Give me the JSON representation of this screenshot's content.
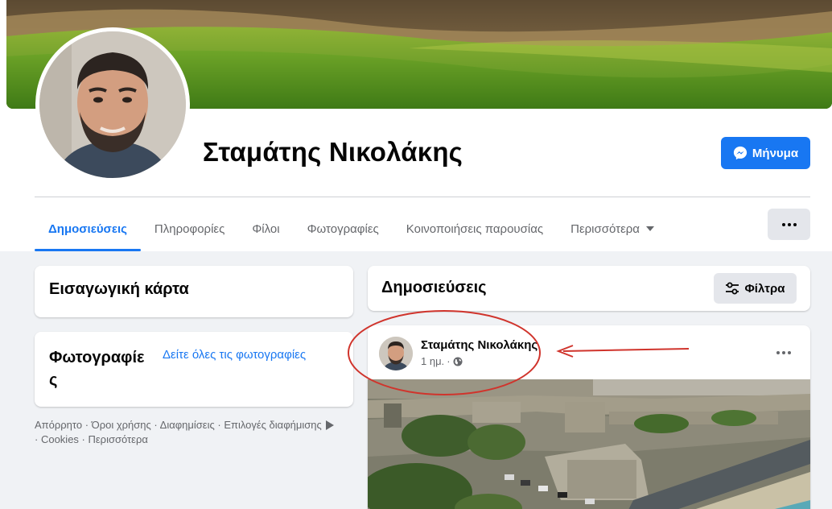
{
  "profile": {
    "name": "Σταμάτης Νικολάκης",
    "message_button": "Μήνυμα"
  },
  "tabs": [
    {
      "label": "Δημοσιεύσεις",
      "active": true
    },
    {
      "label": "Πληροφορίες",
      "active": false
    },
    {
      "label": "Φίλοι",
      "active": false
    },
    {
      "label": "Φωτογραφίες",
      "active": false
    },
    {
      "label": "Κοινοποιήσεις παρουσίας",
      "active": false
    },
    {
      "label": "Περισσότερα",
      "active": false
    }
  ],
  "sidebar": {
    "intro_title": "Εισαγωγική κάρτα",
    "photos_title": "Φωτογραφίες",
    "see_all_photos": "Δείτε όλες τις φωτογραφίες",
    "footer": {
      "privacy": "Απόρρητο",
      "terms": "Όροι χρήσης",
      "ads": "Διαφημίσεις",
      "ad_choices": "Επιλογές διαφήμισης",
      "cookies": "Cookies",
      "more": "Περισσότερα",
      "separator": " · "
    }
  },
  "posts": {
    "header_title": "Δημοσιεύσεις",
    "filters_button": "Φίλτρα",
    "items": [
      {
        "author": "Σταμάτης Νικολάκης",
        "time": "1 ημ.",
        "audience_icon": "globe-icon"
      }
    ]
  },
  "colors": {
    "accent": "#1877f2",
    "annotation": "#d0342c"
  }
}
